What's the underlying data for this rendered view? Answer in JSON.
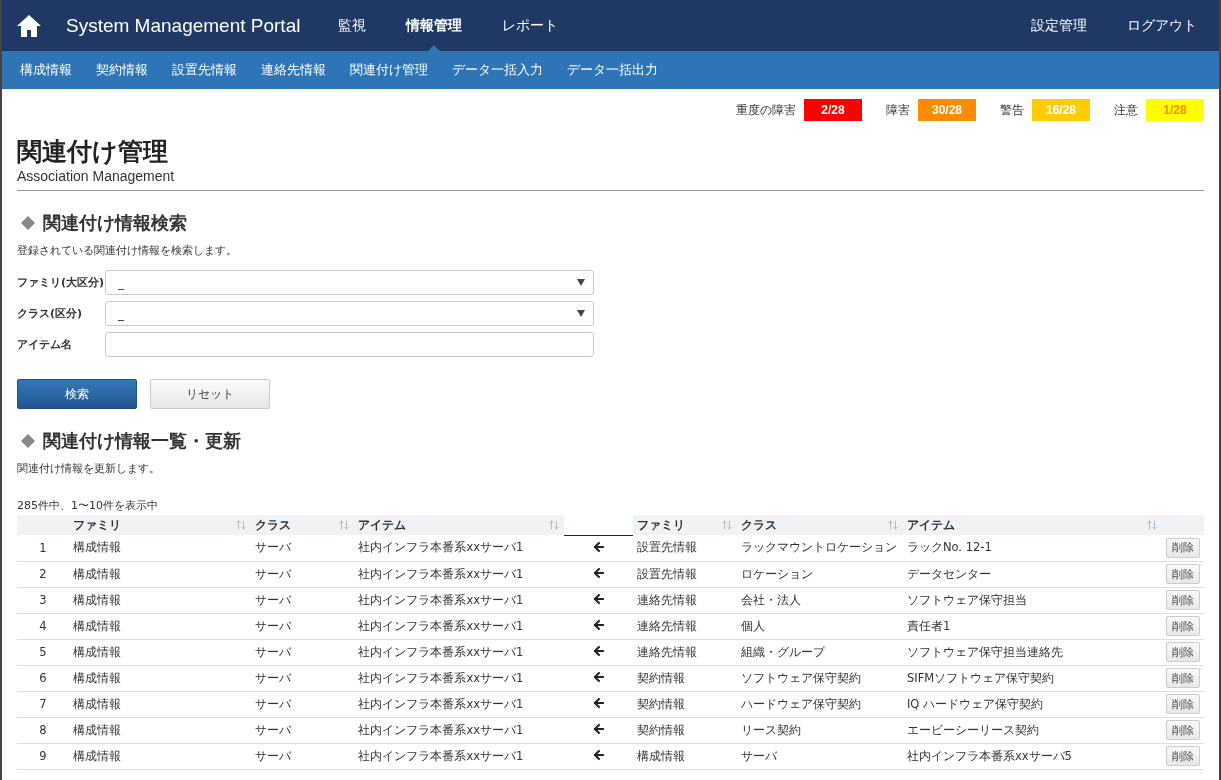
{
  "header": {
    "title": "System Management Portal",
    "nav": [
      {
        "label": "監視",
        "selected": false
      },
      {
        "label": "情報管理",
        "selected": true
      },
      {
        "label": "レポート",
        "selected": false
      }
    ],
    "right_nav": [
      "設定管理",
      "ログアウト"
    ]
  },
  "subnav": [
    "構成情報",
    "契約情報",
    "設置先情報",
    "連絡先情報",
    "関連付け管理",
    "データ一括入力",
    "データ一括出力"
  ],
  "alerts": [
    {
      "label": "重度の障害",
      "count": "2/28",
      "color": "#ff0000"
    },
    {
      "label": "障害",
      "count": "30/28",
      "color": "#ff8c00"
    },
    {
      "label": "警告",
      "count": "16/28",
      "color": "#ffcc00"
    },
    {
      "label": "注意",
      "count": "1/28",
      "color": "#ffff00"
    }
  ],
  "page": {
    "title": "関連付け管理",
    "subtitle": "Association Management"
  },
  "search": {
    "heading": "関連付け情報検索",
    "description": "登録されている関連付け情報を検索します。",
    "fields": [
      {
        "label": "ファミリ(大区分)",
        "kind": "select",
        "value": "_"
      },
      {
        "label": "クラス(区分)",
        "kind": "select",
        "value": "_"
      },
      {
        "label": "アイテム名",
        "kind": "text"
      }
    ],
    "buttons": [
      {
        "label": "検索",
        "kind": "primary"
      },
      {
        "label": "リセット",
        "kind": "secondary"
      }
    ]
  },
  "list": {
    "heading": "関連付け情報一覧・更新",
    "description": "関連付け情報を更新します。",
    "count": "285件中、1〜10件を表示中",
    "left_columns": [
      "ファミリ",
      "クラス",
      "アイテム"
    ],
    "right_columns": [
      "ファミリ",
      "クラス",
      "アイテム"
    ],
    "rows": [
      {
        "no": "1",
        "left": [
          "構成情報",
          "サーバ",
          "社内インフラ本番系xxサーバ1"
        ],
        "right": [
          "設置先情報",
          "ラックマウントロケーション",
          "ラックNo. 12-1"
        ],
        "action": "削除"
      },
      {
        "no": "2",
        "left": [
          "構成情報",
          "サーバ",
          "社内インフラ本番系xxサーバ1"
        ],
        "right": [
          "設置先情報",
          "ロケーション",
          "データセンター"
        ],
        "action": "削除"
      },
      {
        "no": "3",
        "left": [
          "構成情報",
          "サーバ",
          "社内インフラ本番系xxサーバ1"
        ],
        "right": [
          "連絡先情報",
          "会社・法人",
          "ソフトウェア保守担当"
        ],
        "action": "削除"
      },
      {
        "no": "4",
        "left": [
          "構成情報",
          "サーバ",
          "社内インフラ本番系xxサーバ1"
        ],
        "right": [
          "連絡先情報",
          "個人",
          "責任者1"
        ],
        "action": "削除"
      },
      {
        "no": "5",
        "left": [
          "構成情報",
          "サーバ",
          "社内インフラ本番系xxサーバ1"
        ],
        "right": [
          "連絡先情報",
          "組織・グループ",
          "ソフトウェア保守担当連絡先"
        ],
        "action": "削除"
      },
      {
        "no": "6",
        "left": [
          "構成情報",
          "サーバ",
          "社内インフラ本番系xxサーバ1"
        ],
        "right": [
          "契約情報",
          "ソフトウェア保守契約",
          "SIFMソフトウェア保守契約"
        ],
        "action": "削除"
      },
      {
        "no": "7",
        "left": [
          "構成情報",
          "サーバ",
          "社内インフラ本番系xxサーバ1"
        ],
        "right": [
          "契約情報",
          "ハードウェア保守契約",
          "IQ ハードウェア保守契約"
        ],
        "action": "削除"
      },
      {
        "no": "8",
        "left": [
          "構成情報",
          "サーバ",
          "社内インフラ本番系xxサーバ1"
        ],
        "right": [
          "契約情報",
          "リース契約",
          "エービーシーリース契約"
        ],
        "action": "削除"
      },
      {
        "no": "9",
        "left": [
          "構成情報",
          "サーバ",
          "社内インフラ本番系xxサーバ1"
        ],
        "right": [
          "構成情報",
          "サーバ",
          "社内インフラ本番系xxサーバ5"
        ],
        "action": "削除"
      }
    ]
  }
}
